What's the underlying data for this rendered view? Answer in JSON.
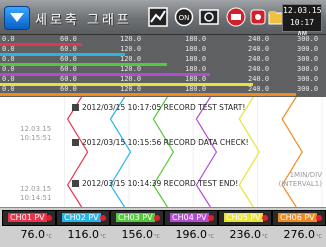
{
  "header": {
    "title": "세로축 그래프",
    "clock_date": "12.03.15",
    "clock_time": "10:17 AM"
  },
  "scale": {
    "ticks": [
      "0.0",
      "60.0",
      "120.0",
      "180.0",
      "240.0",
      "300.0"
    ],
    "channel_bars": [
      {
        "color": "#e8344a",
        "value": 76.0
      },
      {
        "color": "#27b4e6",
        "value": 116.0
      },
      {
        "color": "#54c93a",
        "value": 156.0
      },
      {
        "color": "#b44bd6",
        "value": 196.0
      },
      {
        "color": "#e8e23a",
        "value": 236.0
      },
      {
        "color": "#f08a1e",
        "value": 276.0
      }
    ]
  },
  "chart": {
    "timestamps": [
      {
        "date": "12.03.15",
        "time": "10:15:51"
      },
      {
        "date": "12.03.15",
        "time": "10:14:51"
      }
    ],
    "events": [
      "2012/03/15 10:17:05 RECORD TEST START!",
      "2012/03/15 10:15:56 RECORD DATA CHECK!",
      "2012/03/15 10:14:39 RECORD TEST END!"
    ],
    "interval_line1": "1MIN/DIV",
    "interval_line2": "(INTERVAL1)"
  },
  "channels": [
    {
      "label": "CH01 PV",
      "value": "76.0",
      "unit": "°C",
      "color": "#e8344a"
    },
    {
      "label": "CH02 PV",
      "value": "116.0",
      "unit": "°C",
      "color": "#27b4e6"
    },
    {
      "label": "CH03 PV",
      "value": "156.0",
      "unit": "°C",
      "color": "#54c93a"
    },
    {
      "label": "CH04 PV",
      "value": "196.0",
      "unit": "°C",
      "color": "#b44bd6"
    },
    {
      "label": "CH05 PV",
      "value": "236.0",
      "unit": "°C",
      "color": "#e8e23a"
    },
    {
      "label": "CH06 PV",
      "value": "276.0",
      "unit": "°C",
      "color": "#f08a1e"
    }
  ]
}
